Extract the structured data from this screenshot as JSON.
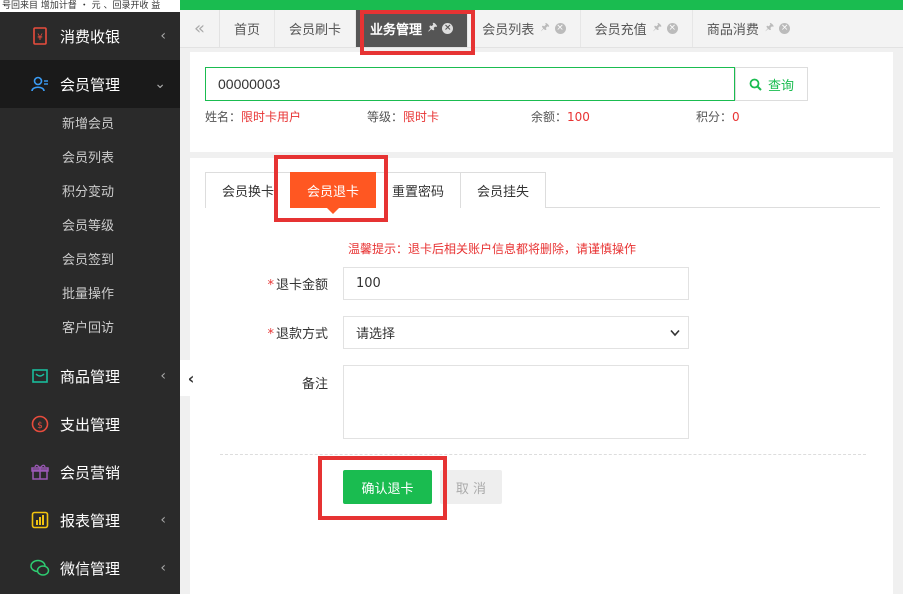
{
  "window": {
    "top_strip_text": "号回来目 增加计督 ・ 元 、回录开收 益"
  },
  "sidebar": {
    "groups": [
      {
        "label": "消费收银",
        "icon": "cashier-icon"
      },
      {
        "label": "会员管理",
        "icon": "member-icon",
        "sub_items": [
          "新增会员",
          "会员列表",
          "积分变动",
          "会员等级",
          "会员签到",
          "批量操作",
          "客户回访"
        ]
      },
      {
        "label": "商品管理",
        "icon": "product-icon"
      },
      {
        "label": "支出管理",
        "icon": "expense-icon"
      },
      {
        "label": "会员营销",
        "icon": "gift-icon"
      },
      {
        "label": "报表管理",
        "icon": "report-icon"
      },
      {
        "label": "微信管理",
        "icon": "wechat-icon"
      }
    ]
  },
  "tabs": {
    "back_icon": "«",
    "items": [
      "首页",
      "会员刷卡",
      "业务管理",
      "会员列表",
      "会员充值",
      "商品消费"
    ],
    "active": "业务管理"
  },
  "search": {
    "value": "00000003",
    "button_label": "查询"
  },
  "member_info": {
    "name_label": "姓名：",
    "name_value": "限时卡用户",
    "level_label": "等级：",
    "level_value": "限时卡",
    "balance_label": "余额：",
    "balance_value": "100",
    "points_label": "积分：",
    "points_value": "0"
  },
  "subtabs": {
    "items": [
      "会员换卡",
      "会员退卡",
      "重置密码",
      "会员挂失"
    ],
    "active": "会员退卡"
  },
  "form": {
    "warning": "温馨提示：退卡后相关账户信息都将删除，请谨慎操作",
    "amount_label": "退卡金额",
    "amount_value": "100",
    "method_label": "退款方式",
    "method_value": "请选择",
    "remark_label": "备注",
    "remark_value": "",
    "confirm_label": "确认退卡",
    "cancel_label": "取 消"
  },
  "colors": {
    "accent": "#1abc50",
    "highlight": "#ff5722",
    "warning": "#e83333",
    "sidebar": "#2a2a2a"
  }
}
